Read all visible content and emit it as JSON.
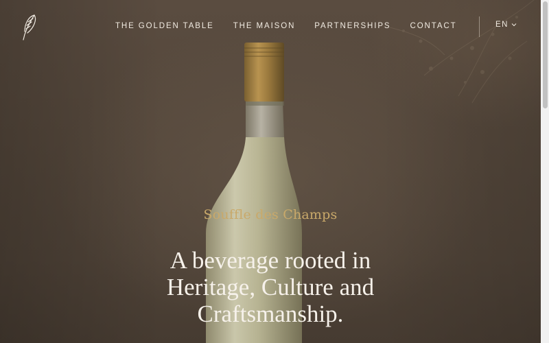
{
  "nav": {
    "logo_icon": "wheat-feather-icon",
    "links": [
      {
        "label": "THE GOLDEN TABLE"
      },
      {
        "label": "THE MAISON"
      },
      {
        "label": "PARTNERSHIPS"
      },
      {
        "label": "CONTACT"
      }
    ],
    "language": {
      "label": "EN",
      "icon": "chevron-down-icon"
    }
  },
  "hero": {
    "eyebrow": "Souffle des Champs",
    "headline": "A beverage rooted in Heritage, Culture and Craftsmanship.",
    "background": "bottle-photo"
  },
  "colors": {
    "accent_gold": "#c9a96a",
    "text_light": "#f1ebe2",
    "background_brown": "#54473b"
  }
}
